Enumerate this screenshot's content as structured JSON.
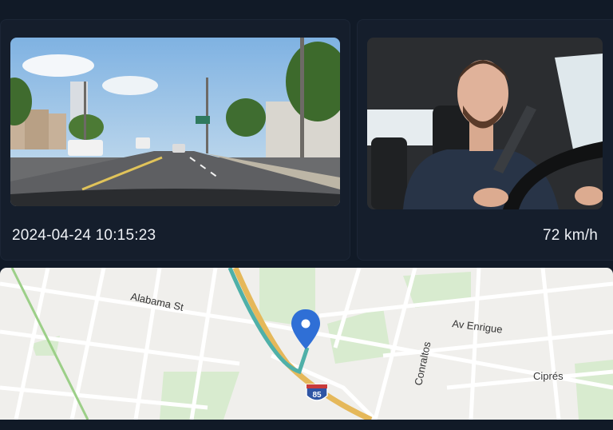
{
  "road_camera": {
    "timestamp": "2024-04-24 10:15:23"
  },
  "cabin_camera": {
    "speed": "72 km/h"
  },
  "map": {
    "streets": {
      "alabama": "Alabama St",
      "enrigue": "Av Enrigue",
      "conraltos": "Conraltos",
      "cipres": "Ciprés"
    },
    "highway_shield": "85",
    "colors": {
      "route": "#4fb0a8",
      "highway": "#e5b85a",
      "pin": "#2f6fd6",
      "park": "#d8ebcf"
    },
    "icons": [
      "location-pin-icon",
      "interstate-shield-icon"
    ]
  }
}
